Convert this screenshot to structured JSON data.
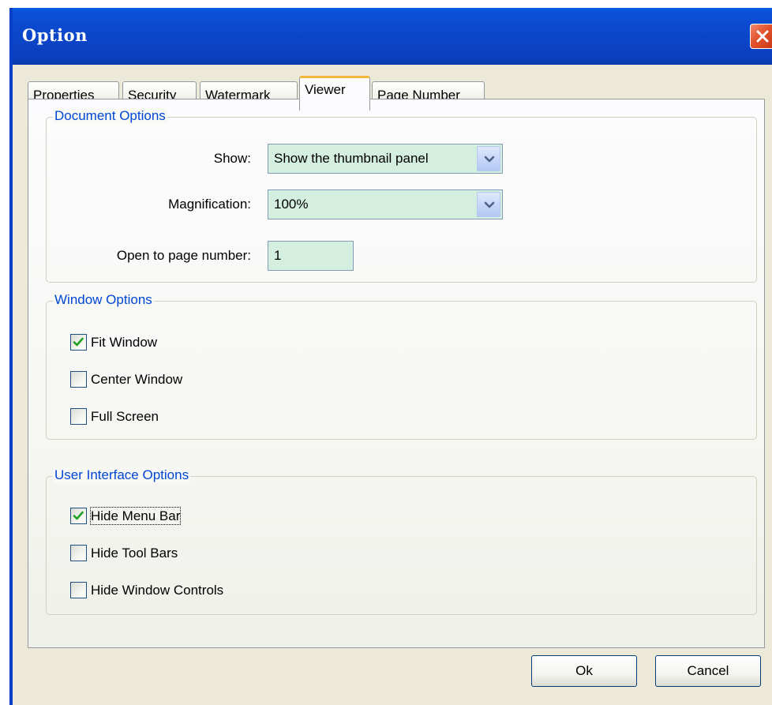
{
  "window": {
    "title": "Option"
  },
  "tabs": [
    {
      "label": "Properties",
      "active": false
    },
    {
      "label": "Security",
      "active": false
    },
    {
      "label": "Watermark",
      "active": false
    },
    {
      "label": "Viewer",
      "active": true
    },
    {
      "label": "Page Number",
      "active": false
    }
  ],
  "document_options": {
    "legend": "Document Options",
    "show_label": "Show:",
    "show_value": "Show the thumbnail panel",
    "magnification_label": "Magnification:",
    "magnification_value": "100%",
    "page_label": "Open to page number:",
    "page_value": "1"
  },
  "window_options": {
    "legend": "Window Options",
    "items": [
      {
        "label": "Fit Window",
        "checked": true
      },
      {
        "label": "Center Window",
        "checked": false
      },
      {
        "label": "Full Screen",
        "checked": false
      }
    ]
  },
  "ui_options": {
    "legend": "User Interface Options",
    "items": [
      {
        "label": "Hide Menu Bar",
        "checked": true
      },
      {
        "label": "Hide Tool Bars",
        "checked": false
      },
      {
        "label": "Hide Window Controls",
        "checked": false
      }
    ]
  },
  "buttons": {
    "ok": "Ok",
    "cancel": "Cancel"
  },
  "colors": {
    "titlebar": "#0b46c9",
    "dialog_bg": "#ece9d8",
    "field_bg": "#d4eedf",
    "legend_text": "#0046d5",
    "active_tab_accent": "#f5b63c",
    "check_mark": "#21a121",
    "close_button": "#e2512b"
  },
  "icons": {
    "close": "close-icon",
    "dropdown": "chevron-down-icon",
    "check": "check-icon"
  }
}
